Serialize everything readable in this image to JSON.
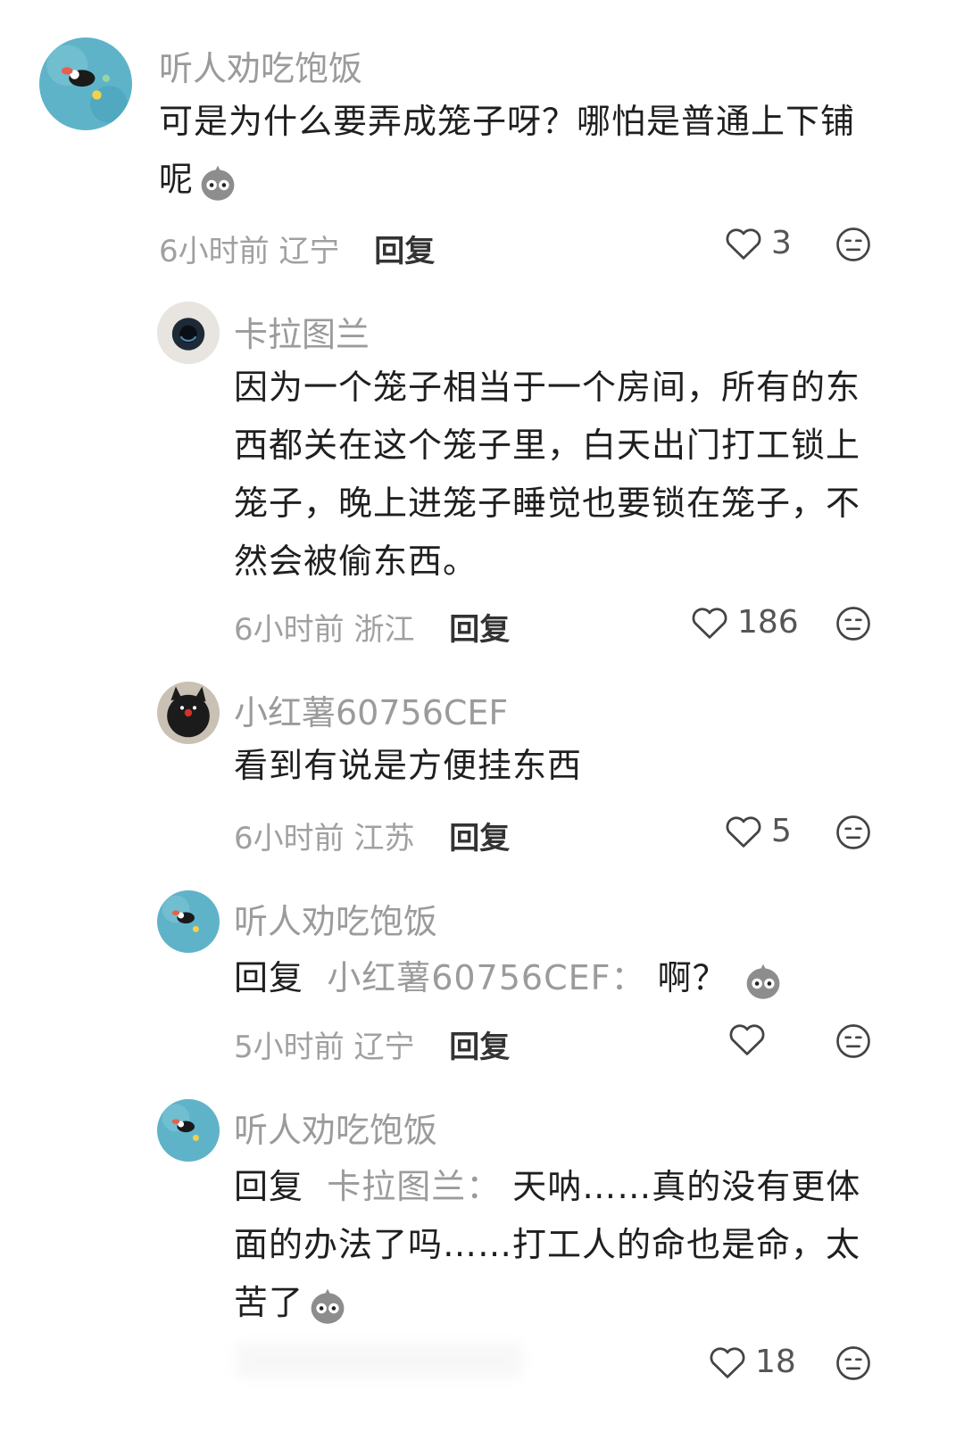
{
  "comments": [
    {
      "username": "听人劝吃饱饭",
      "text": "可是为什么要弄成笼子呀？哪怕是普通上下铺",
      "text2": "呢",
      "time": "6小时前",
      "location": "辽宁",
      "reply_label": "回复",
      "likes": "3"
    },
    {
      "username": "卡拉图兰",
      "lines": [
        "因为一个笼子相当于一个房间，所有的东",
        "西都关在这个笼子里，白天出门打工锁上",
        "笼子，晚上进笼子睡觉也要锁在笼子，不",
        "然会被偷东西。"
      ],
      "time": "6小时前",
      "location": "浙江",
      "reply_label": "回复",
      "likes": "186"
    },
    {
      "username": "小红薯60756CEF",
      "text": "看到有说是方便挂东西",
      "time": "6小时前",
      "location": "江苏",
      "reply_label": "回复",
      "likes": "5"
    },
    {
      "username": "听人劝吃饱饭",
      "reply_prefix": "回复",
      "reply_target": "小红薯60756CEF：",
      "text": "啊？",
      "time": "5小时前",
      "location": "辽宁",
      "reply_label": "回复",
      "likes": ""
    },
    {
      "username": "听人劝吃饱饭",
      "reply_prefix": "回复",
      "reply_target": "卡拉图兰：",
      "lines": [
        "天呐……真的没有更体",
        "面的办法了吗……打工人的命也是命，太",
        "苦了"
      ],
      "likes": "18"
    }
  ],
  "colors": {
    "username": "#9b9b9b",
    "text": "#1f1f1f",
    "meta": "#a0a0a0"
  }
}
